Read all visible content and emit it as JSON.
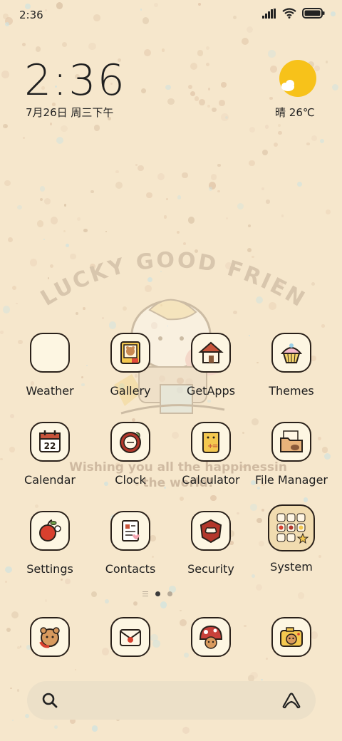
{
  "status_bar": {
    "time": "2:36"
  },
  "clock_widget": {
    "time": "2:36",
    "date": "7月26日 周三下午"
  },
  "weather_widget": {
    "condition": "晴",
    "temperature": "26℃"
  },
  "wallpaper": {
    "title": "LUCKY GOOD FRIEND",
    "caption_line1": "Wishing you all the happinessin",
    "caption_line2": "the world!"
  },
  "apps": [
    {
      "label": "Weather",
      "icon": "blank-icon"
    },
    {
      "label": "Gallery",
      "icon": "bear-photo-icon"
    },
    {
      "label": "GetApps",
      "icon": "house-icon"
    },
    {
      "label": "Themes",
      "icon": "cupcake-icon"
    },
    {
      "label": "Calendar",
      "icon": "calendar-icon",
      "badge": "22"
    },
    {
      "label": "Clock",
      "icon": "clock-icon"
    },
    {
      "label": "Calculator",
      "icon": "calculator-icon"
    },
    {
      "label": "File Manager",
      "icon": "folder-icon"
    },
    {
      "label": "Settings",
      "icon": "apple-icon"
    },
    {
      "label": "Contacts",
      "icon": "notebook-icon"
    },
    {
      "label": "Security",
      "icon": "shield-icon"
    },
    {
      "label": "System",
      "icon": "folder-grid-icon"
    }
  ],
  "dock": [
    {
      "icon": "bear-phone-icon"
    },
    {
      "icon": "envelope-icon"
    },
    {
      "icon": "mushroom-bear-icon"
    },
    {
      "icon": "camera-bear-icon"
    }
  ],
  "search": {
    "left_icon": "search-icon",
    "right_icon": "assistant-icon"
  },
  "colors": {
    "background": "#f6e7cc",
    "icon_bg": "#fdf6e2",
    "outline": "#2a211a",
    "sun": "#f7c21a"
  }
}
